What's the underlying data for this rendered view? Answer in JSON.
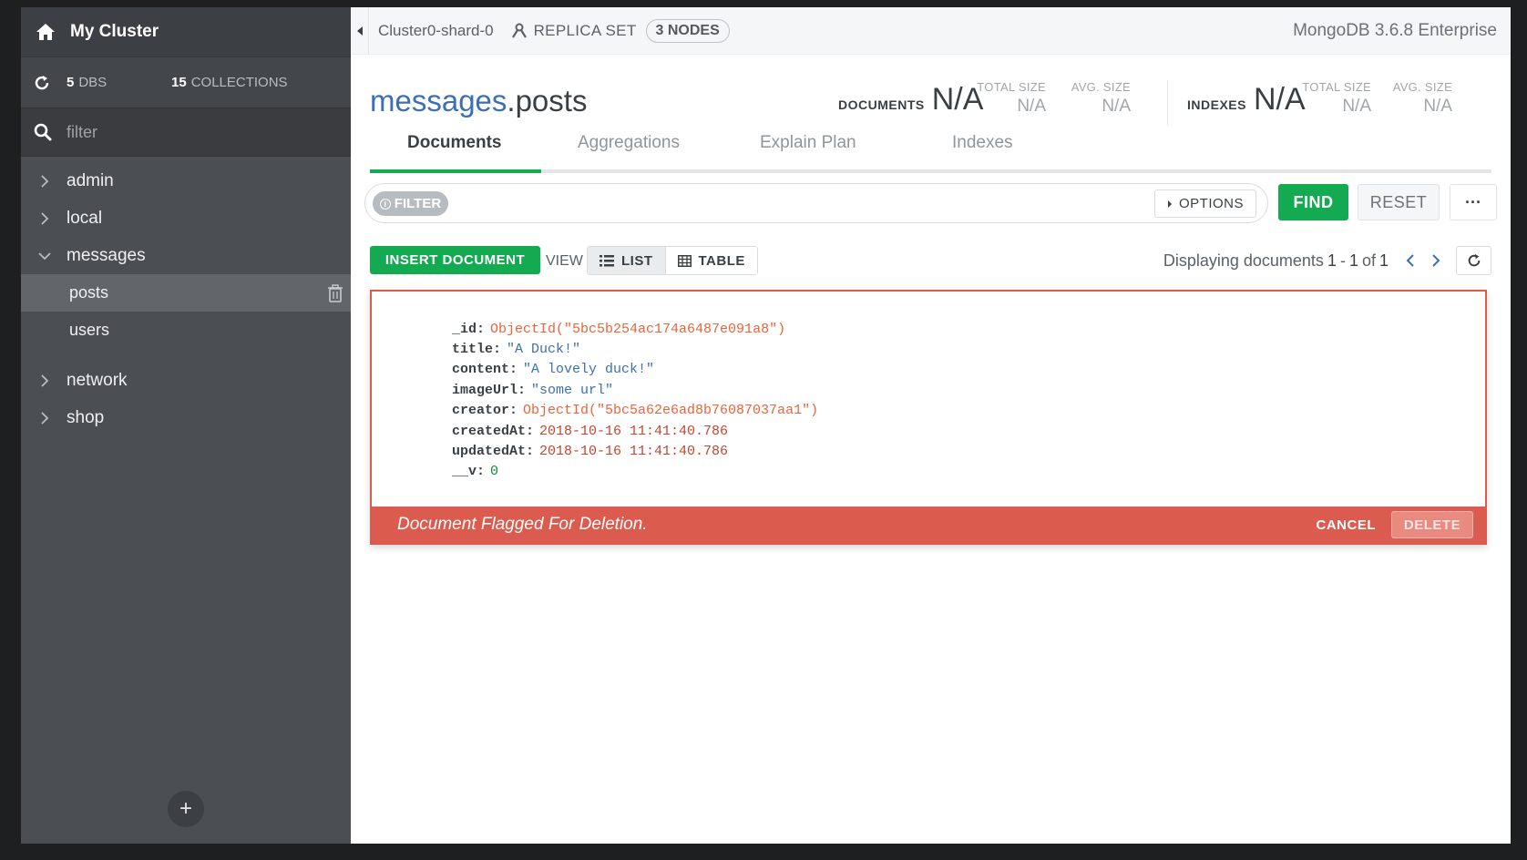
{
  "sidebar": {
    "cluster_name": "My Cluster",
    "dbs_count": "5",
    "dbs_label": "DBS",
    "collections_count": "15",
    "collections_label": "COLLECTIONS",
    "filter_placeholder": "filter",
    "databases": [
      {
        "name": "admin",
        "expanded": false
      },
      {
        "name": "local",
        "expanded": false
      },
      {
        "name": "messages",
        "expanded": true,
        "collections": [
          "posts",
          "users"
        ],
        "active_collection": "posts"
      },
      {
        "name": "network",
        "expanded": false
      },
      {
        "name": "shop",
        "expanded": false
      }
    ],
    "add_label": "+"
  },
  "topbar": {
    "shard": "Cluster0-shard-0",
    "replica_set": "REPLICA SET",
    "nodes": "3 NODES",
    "version": "MongoDB 3.6.8 Enterprise"
  },
  "collection": {
    "db": "messages",
    "separator": ".",
    "name": "posts",
    "documents_label": "DOCUMENTS",
    "documents_value": "N/A",
    "doc_total_size_label": "TOTAL SIZE",
    "doc_total_size_value": "N/A",
    "doc_avg_size_label": "AVG. SIZE",
    "doc_avg_size_value": "N/A",
    "indexes_label": "INDEXES",
    "indexes_value": "N/A",
    "idx_total_size_label": "TOTAL SIZE",
    "idx_total_size_value": "N/A",
    "idx_avg_size_label": "AVG. SIZE",
    "idx_avg_size_value": "N/A"
  },
  "tabs": [
    {
      "label": "Documents",
      "active": true
    },
    {
      "label": "Aggregations",
      "active": false
    },
    {
      "label": "Explain Plan",
      "active": false
    },
    {
      "label": "Indexes",
      "active": false
    }
  ],
  "query": {
    "filter_label": "FILTER",
    "options_label": "OPTIONS",
    "find_label": "FIND",
    "reset_label": "RESET",
    "more_label": "···"
  },
  "doc_toolbar": {
    "insert_label": "INSERT DOCUMENT",
    "view_label": "VIEW",
    "list_label": "LIST",
    "table_label": "TABLE",
    "paging_prefix": "Displaying documents",
    "paging_start": "1",
    "paging_dash": "-",
    "paging_end": "1",
    "paging_of": "of",
    "paging_total": "1"
  },
  "document": {
    "fields": [
      {
        "key": "_id:",
        "value": "ObjectId(\"5bc5b254ac174a6487e091a8\")",
        "type": "oid"
      },
      {
        "key": "title:",
        "value": "\"A Duck!\"",
        "type": "str"
      },
      {
        "key": "content:",
        "value": "\"A lovely duck!\"",
        "type": "str"
      },
      {
        "key": "imageUrl:",
        "value": "\"some url\"",
        "type": "str"
      },
      {
        "key": "creator:",
        "value": "ObjectId(\"5bc5a62e6ad8b76087037aa1\")",
        "type": "oid"
      },
      {
        "key": "createdAt:",
        "value": "2018-10-16 11:41:40.786",
        "type": "date"
      },
      {
        "key": "updatedAt:",
        "value": "2018-10-16 11:41:40.786",
        "type": "date"
      },
      {
        "key": "__v:",
        "value": "0",
        "type": "num"
      }
    ],
    "flag_message": "Document Flagged For Deletion.",
    "cancel_label": "CANCEL",
    "delete_label": "DELETE"
  },
  "colors": {
    "accent_green": "#13aa52",
    "delete_red": "#db5b4f",
    "link_blue": "#3d6fb3",
    "sidebar_bg": "#4b4e53"
  },
  "icons": {
    "home": "home-icon",
    "refresh": "refresh-icon",
    "search": "search-icon",
    "chevron_right": "chevron-right-icon",
    "chevron_down": "chevron-down-icon",
    "trash": "trash-icon",
    "replica": "replica-set-icon"
  }
}
